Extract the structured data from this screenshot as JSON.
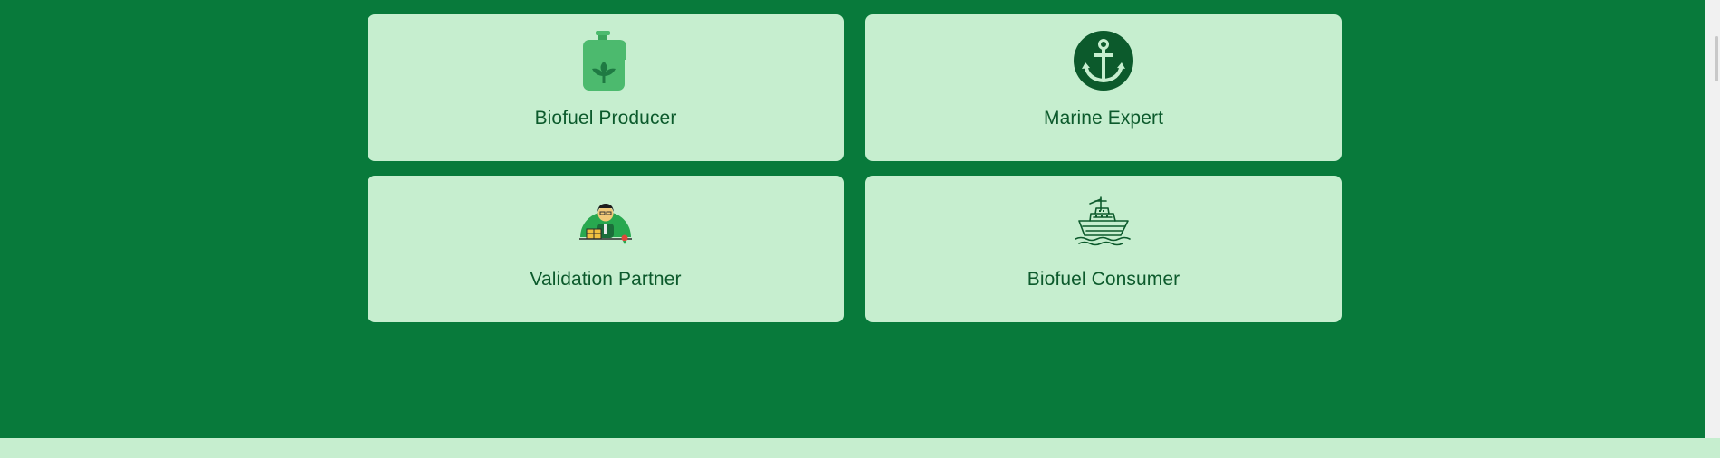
{
  "colors": {
    "page_background": "#087a3b",
    "card_background": "#c6eecf",
    "label_text": "#0c5a2c",
    "footer_band": "#c6eecf"
  },
  "cards": [
    {
      "label": "Biofuel Producer",
      "icon": "biofuel-canister-icon"
    },
    {
      "label": "Marine Expert",
      "icon": "anchor-icon"
    },
    {
      "label": "Validation Partner",
      "icon": "validator-person-icon"
    },
    {
      "label": "Biofuel Consumer",
      "icon": "cargo-ship-icon"
    }
  ]
}
